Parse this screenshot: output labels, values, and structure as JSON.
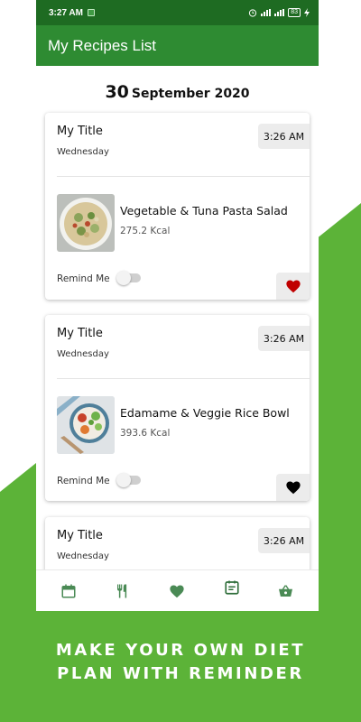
{
  "colors": {
    "brand_green": "#5cb338",
    "status_bar": "#1e6b22",
    "app_bar": "#2e8b32",
    "nav_icon": "#4a8a55",
    "heart_active": "#c00000",
    "heart_inactive": "#000000"
  },
  "status_bar": {
    "time": "3:27 AM",
    "battery": "83",
    "icons": [
      "app-notification-icon",
      "alarm-icon",
      "signal-icon",
      "battery-icon",
      "charging-icon"
    ]
  },
  "app_bar": {
    "title": "My Recipes List"
  },
  "date_heading": {
    "day": "30",
    "month_year": "September 2020"
  },
  "cards": [
    {
      "title": "My Title",
      "weekday": "Wednesday",
      "time": "3:26 AM",
      "recipe": "Vegetable & Tuna Pasta Salad",
      "kcal": "275.2 Kcal",
      "remind_label": "Remind Me",
      "remind_on": false,
      "favorite": true,
      "thumb_icon": "pasta-salad-photo"
    },
    {
      "title": "My Title",
      "weekday": "Wednesday",
      "time": "3:26 AM",
      "recipe": "Edamame & Veggie Rice Bowl",
      "kcal": "393.6 Kcal",
      "remind_label": "Remind Me",
      "remind_on": false,
      "favorite": false,
      "thumb_icon": "rice-bowl-photo"
    },
    {
      "title": "My Title",
      "weekday": "Wednesday",
      "time": "3:26 AM"
    }
  ],
  "bottom_nav": {
    "items": [
      "calendar-icon",
      "restaurant-icon",
      "favorites-icon",
      "meal-plan-icon",
      "shopping-basket-icon"
    ],
    "active": "meal-plan-icon"
  },
  "tagline": {
    "line1": "MAKE YOUR OWN DIET",
    "line2": "PLAN WITH REMINDER"
  }
}
